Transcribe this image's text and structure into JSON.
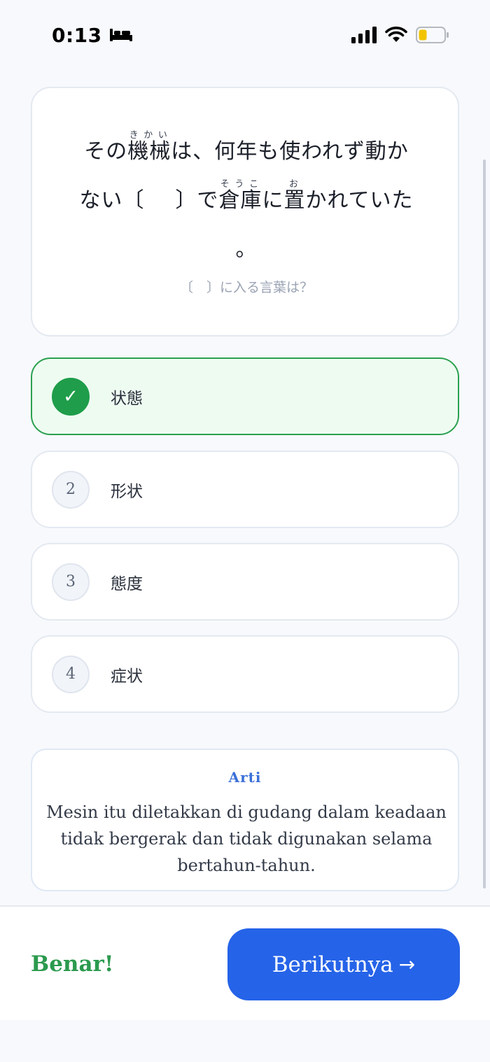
{
  "status_bar": {
    "time": "0:13",
    "icons": [
      "bed-icon",
      "signal-icon",
      "wifi-icon",
      "battery-icon"
    ]
  },
  "question": {
    "sentence": {
      "part1": "その",
      "kikai_base": "機械",
      "kikai_ruby": "きかい",
      "part2": "は、何年も使われず動か",
      "part3": "ない〔",
      "part4": "〕で",
      "souko_base": "倉庫",
      "souko_ruby": "そうこ",
      "part5": "に",
      "oku_base": "置",
      "oku_ruby": "お",
      "part6": "かれていた",
      "part7": "。"
    },
    "hint": "〔　〕に入る言葉は？"
  },
  "options": [
    {
      "badge": "✓",
      "label": "状態",
      "state": "correct"
    },
    {
      "badge": "2",
      "label": "形状",
      "state": "default"
    },
    {
      "badge": "3",
      "label": "態度",
      "state": "default"
    },
    {
      "badge": "4",
      "label": "症状",
      "state": "default"
    }
  ],
  "translation": {
    "title": "Arti",
    "text": "Mesin itu diletakkan di gudang dalam keadaan tidak bergerak dan tidak digunakan selama bertahun-tahun."
  },
  "footer": {
    "result": "Benar!",
    "next_label": "Berikutnya",
    "next_arrow": "→"
  },
  "colors": {
    "accent_blue": "#2563e8",
    "correct_green": "#1f9d4a",
    "correct_bg": "#eefbf1",
    "background": "#f7f9fc"
  }
}
